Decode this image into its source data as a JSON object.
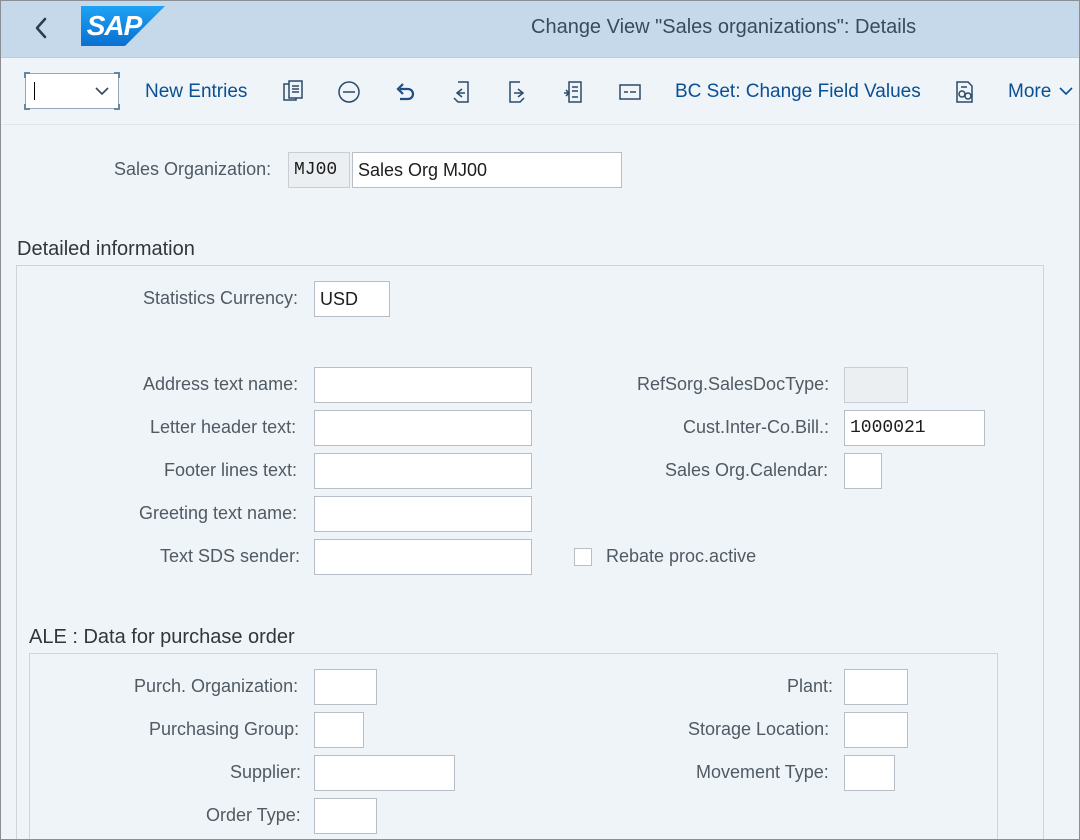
{
  "shell": {
    "logo_text": "SAP",
    "title": "Change View \"Sales organizations\": Details",
    "back_icon": "chevron-left-icon"
  },
  "toolbar": {
    "command_field_value": "",
    "new_entries_label": "New Entries",
    "bc_set_label": "BC Set: Change Field Values",
    "more_label": "More",
    "icons": [
      "copy-icon",
      "delete-icon",
      "undo-icon",
      "previous-entry-icon",
      "next-entry-icon",
      "variable-list-icon",
      "select-icon",
      "where-used-icon"
    ]
  },
  "header": {
    "sales_org_label": "Sales Organization:",
    "sales_org_code": "MJ00",
    "sales_org_name": "Sales Org MJ00"
  },
  "detailed": {
    "title": "Detailed information",
    "statistics_currency_label": "Statistics Currency:",
    "statistics_currency_value": "USD",
    "address_text_label": "Address text name:",
    "address_text_value": "",
    "letter_header_label": "Letter header text:",
    "letter_header_value": "",
    "footer_lines_label": "Footer lines text:",
    "footer_lines_value": "",
    "greeting_text_label": "Greeting text name:",
    "greeting_text_value": "",
    "text_sds_label": "Text SDS sender:",
    "text_sds_value": "",
    "refsorg_label": "RefSorg.SalesDocType:",
    "refsorg_value": "",
    "cust_interco_label": "Cust.Inter-Co.Bill.:",
    "cust_interco_value": "1000021",
    "calendar_label": "Sales Org.Calendar:",
    "calendar_value": "",
    "rebate_label": "Rebate proc.active",
    "rebate_checked": false
  },
  "ale": {
    "title": "ALE : Data for purchase order",
    "purch_org_label": "Purch. Organization:",
    "purch_org_value": "",
    "purch_group_label": "Purchasing Group:",
    "purch_group_value": "",
    "supplier_label": "Supplier:",
    "supplier_value": "",
    "order_type_label": "Order Type:",
    "order_type_value": "",
    "plant_label": "Plant:",
    "plant_value": "",
    "storage_location_label": "Storage Location:",
    "storage_location_value": "",
    "movement_type_label": "Movement Type:",
    "movement_type_value": ""
  },
  "colors": {
    "shell_bg": "#c5d9ea",
    "app_bg": "#eff4f9",
    "link_blue": "#0a4f92",
    "logo_blue": "#1d8de8"
  }
}
